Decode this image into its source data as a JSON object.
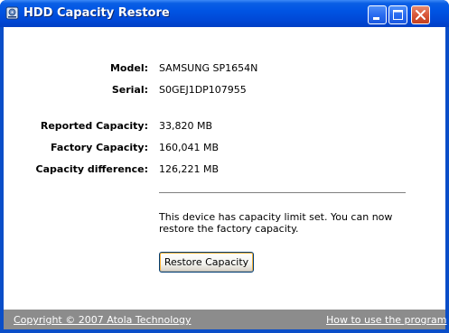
{
  "window": {
    "title": "HDD Capacity Restore",
    "app_icon": "hdd-app-icon",
    "controls": [
      "minimize-icon",
      "maximize-icon",
      "close-icon"
    ]
  },
  "device": {
    "model_label": "Model:",
    "model_value": "SAMSUNG SP1654N",
    "serial_label": "Serial:",
    "serial_value": "S0GEJ1DP107955"
  },
  "capacity": {
    "reported_label": "Reported Capacity:",
    "reported_value": "33,820 MB",
    "factory_label": "Factory Capacity:",
    "factory_value": "160,041 MB",
    "difference_label": "Capacity difference:",
    "difference_value": "126,221 MB"
  },
  "message": "This device has capacity limit set. You can now restore the factory capacity.",
  "actions": {
    "restore_label": "Restore Capacity"
  },
  "footer": {
    "copyright": "Copyright © 2007 Atola Technology",
    "help_link": "How to use the program"
  },
  "colors": {
    "titlebar": "#0054e3",
    "footer": "#8c8c8c",
    "content_bg": "#ffffff"
  }
}
